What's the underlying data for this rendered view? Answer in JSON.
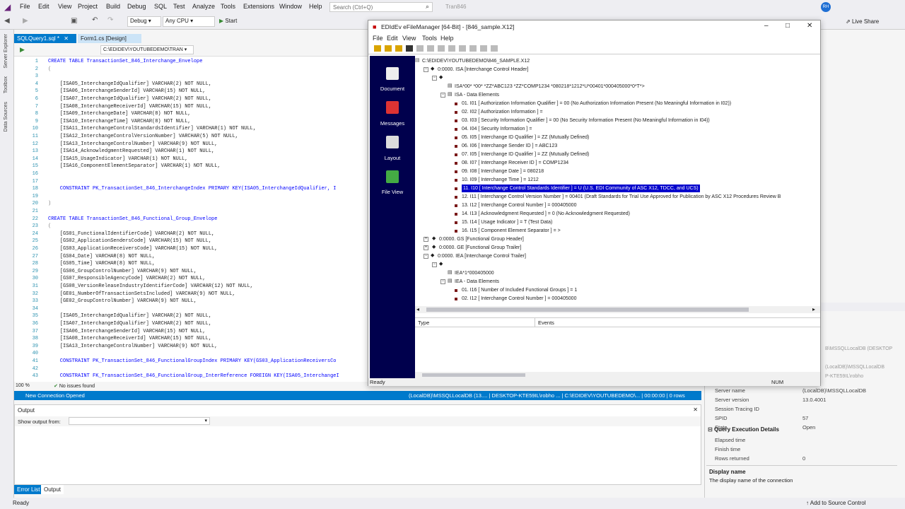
{
  "vs": {
    "menu": [
      "File",
      "Edit",
      "View",
      "Project",
      "Build",
      "Debug",
      "SQL",
      "Test",
      "Analyze",
      "Tools",
      "Extensions",
      "Window",
      "Help"
    ],
    "search_placeholder": "Search (Ctrl+Q)",
    "solution": "Tran846",
    "avatar": "RH",
    "live_share": "Live Share",
    "config": "Debug",
    "platform": "Any CPU",
    "start": "Start",
    "rail": [
      "Server Explorer",
      "Toolbox",
      "Data Sources"
    ],
    "tabs": [
      "SQLQuery1.sql *",
      "Form1.cs [Design]"
    ],
    "path": "C:\\EDIDEV\\YOUTUBEDEMO\\TRAN",
    "zoom": "100 %",
    "issues": "No issues found",
    "conn_status": "New Connection Opened",
    "conn_info": "(LocalDB)\\MSSQLLocalDB (13.... | DESKTOP-KTE59IL\\robho ... | C:\\EDIDEV\\YOUTUBEDEMO\\... | 00:00:00 | 0 rows",
    "output_title": "Output",
    "output_from": "Show output from:",
    "bottom_tabs": [
      "Error List",
      "Output"
    ],
    "status_left": "Ready",
    "status_right": "Add to Source Control"
  },
  "code": [
    {
      "n": "1",
      "t": "CREATE TABLE TransactionSet_846_Interchange_Envelope"
    },
    {
      "n": "2",
      "t": "("
    },
    {
      "n": "3",
      "t": ""
    },
    {
      "n": "4",
      "t": "    [ISA05_InterchangeIdQualifier] VARCHAR(2) NOT NULL,"
    },
    {
      "n": "5",
      "t": "    [ISA06_InterchangeSenderId] VARCHAR(15) NOT NULL,"
    },
    {
      "n": "6",
      "t": "    [ISA07_InterchangeIdQualifier] VARCHAR(2) NOT NULL,"
    },
    {
      "n": "7",
      "t": "    [ISA08_InterchangeReceiverId] VARCHAR(15) NOT NULL,"
    },
    {
      "n": "8",
      "t": "    [ISA09_InterchangeDate] VARCHAR(8) NOT NULL,"
    },
    {
      "n": "9",
      "t": "    [ISA10_InterchangeTime] VARCHAR(8) NOT NULL,"
    },
    {
      "n": "10",
      "t": "    [ISA11_InterchangeControlStandardsIdentifier] VARCHAR(1) NOT NULL,"
    },
    {
      "n": "11",
      "t": "    [ISA12_InterchangeControlVersionNumber] VARCHAR(5) NOT NULL,"
    },
    {
      "n": "12",
      "t": "    [ISA13_InterchangeControlNumber] VARCHAR(9) NOT NULL,"
    },
    {
      "n": "13",
      "t": "    [ISA14_AcknowledgmentRequested] VARCHAR(1) NOT NULL,"
    },
    {
      "n": "14",
      "t": "    [ISA15_UsageIndicator] VARCHAR(1) NOT NULL,"
    },
    {
      "n": "15",
      "t": "    [ISA16_ComponentElementSeparator] VARCHAR(1) NOT NULL,"
    },
    {
      "n": "16",
      "t": ""
    },
    {
      "n": "17",
      "t": ""
    },
    {
      "n": "18",
      "t": "    CONSTRAINT PK_TransactionSet_846_InterchangeIndex PRIMARY KEY(ISA05_InterchangeIdQualifier, I"
    },
    {
      "n": "19",
      "t": ""
    },
    {
      "n": "20",
      "t": ")"
    },
    {
      "n": "21",
      "t": ""
    },
    {
      "n": "22",
      "t": "CREATE TABLE TransactionSet_846_Functional_Group_Envelope"
    },
    {
      "n": "23",
      "t": "("
    },
    {
      "n": "24",
      "t": "    [GS01_FunctionalIdentifierCode] VARCHAR(2) NOT NULL,"
    },
    {
      "n": "25",
      "t": "    [GS02_ApplicationSendersCode] VARCHAR(15) NOT NULL,"
    },
    {
      "n": "26",
      "t": "    [GS03_ApplicationReceiversCode] VARCHAR(15) NOT NULL,"
    },
    {
      "n": "27",
      "t": "    [GS04_Date] VARCHAR(8) NOT NULL,"
    },
    {
      "n": "28",
      "t": "    [GS05_Time] VARCHAR(8) NOT NULL,"
    },
    {
      "n": "29",
      "t": "    [GS06_GroupControlNumber] VARCHAR(9) NOT NULL,"
    },
    {
      "n": "30",
      "t": "    [GS07_ResponsibleAgencyCode] VARCHAR(2) NOT NULL,"
    },
    {
      "n": "31",
      "t": "    [GS08_VersionReleaseIndustryIdentifierCode] VARCHAR(12) NOT NULL,"
    },
    {
      "n": "32",
      "t": "    [GE01_NumberOfTransactionSetsIncluded] VARCHAR(9) NOT NULL,"
    },
    {
      "n": "33",
      "t": "    [GE02_GroupControlNumber] VARCHAR(9) NOT NULL,"
    },
    {
      "n": "34",
      "t": ""
    },
    {
      "n": "35",
      "t": "    [ISA05_InterchangeIdQualifier] VARCHAR(2) NOT NULL,"
    },
    {
      "n": "36",
      "t": "    [ISA07_InterchangeIdQualifier] VARCHAR(2) NOT NULL,"
    },
    {
      "n": "37",
      "t": "    [ISA06_InterchangeSenderId] VARCHAR(15) NOT NULL,"
    },
    {
      "n": "38",
      "t": "    [ISA08_InterchangeReceiverId] VARCHAR(15) NOT NULL,"
    },
    {
      "n": "39",
      "t": "    [ISA13_InterchangeControlNumber] VARCHAR(9) NOT NULL,"
    },
    {
      "n": "40",
      "t": ""
    },
    {
      "n": "41",
      "t": "    CONSTRAINT PK_TransactionSet_846_FunctionalGroupIndex PRIMARY KEY(GS03_ApplicationReceiversCo"
    },
    {
      "n": "42",
      "t": ""
    },
    {
      "n": "43",
      "t": "    CONSTRAINT FK_TransactionSet_846_FunctionalGroup_InterReference FOREIGN KEY(ISA05_InterchangeI"
    }
  ],
  "edi": {
    "title": "EDIdEv eFileManager [64-Bit] - [846_sample.X12]",
    "menu": [
      "File",
      "Edit",
      "View",
      "Tools",
      "Help"
    ],
    "nav": [
      "Document",
      "Messages",
      "Layout",
      "File View"
    ],
    "events_cols": [
      "Type",
      "Events"
    ],
    "status": "Ready",
    "status_num": "NUM",
    "tree": [
      {
        "lvl": 0,
        "box": "",
        "t": "C:\\EDIDEV\\YOUTUBEDEMO\\846_SAMPLE.X12"
      },
      {
        "lvl": 1,
        "box": "-",
        "t": "0:0000. ISA [Interchange Control Header]"
      },
      {
        "lvl": 2,
        "box": "-",
        "t": ""
      },
      {
        "lvl": 3,
        "box": "",
        "t": "ISA*00*          *00*          *ZZ*ABC123         *ZZ*COMP1234       *080218*1212*U*00401*000405000*0*T*>"
      },
      {
        "lvl": 3,
        "box": "-",
        "t": "ISA - Data Elements"
      },
      {
        "lvl": 4,
        "box": "",
        "t": "01. I01 [ Authorization Information Qualifier ] = 00 (No Authorization Information Present (No Meaningful Information in I02))"
      },
      {
        "lvl": 4,
        "box": "",
        "t": "02. I02 [ Authorization Information ] ="
      },
      {
        "lvl": 4,
        "box": "",
        "t": "03. I03 [ Security Information Qualifier ] = 00 (No Security Information Present (No Meaningful Information in I04))"
      },
      {
        "lvl": 4,
        "box": "",
        "t": "04. I04 [ Security Information ] ="
      },
      {
        "lvl": 4,
        "box": "",
        "t": "05. I05 [ Interchange ID Qualifier ] = ZZ (Mutually Defined)"
      },
      {
        "lvl": 4,
        "box": "",
        "t": "06. I06 [ Interchange Sender ID ] = ABC123"
      },
      {
        "lvl": 4,
        "box": "",
        "t": "07. I05 [ Interchange ID Qualifier ] = ZZ (Mutually Defined)"
      },
      {
        "lvl": 4,
        "box": "",
        "t": "08. I07 [ Interchange Receiver ID ] = COMP1234"
      },
      {
        "lvl": 4,
        "box": "",
        "t": "09. I08 [ Interchange Date ] = 080218"
      },
      {
        "lvl": 4,
        "box": "",
        "t": "10. I09 [ Interchange Time ] = 1212"
      },
      {
        "lvl": 4,
        "box": "",
        "t": "11. I10 [ Interchange Control Standards Identifier ] = U (U.S. EDI Community of ASC X12, TDCC, and UCS)",
        "sel": true
      },
      {
        "lvl": 4,
        "box": "",
        "t": "12. I11 [ Interchange Control Version Number ] = 00401 (Draft Standards for Trial Use Approved for Publication by ASC X12 Procedures Review B"
      },
      {
        "lvl": 4,
        "box": "",
        "t": "13. I12 [ Interchange Control Number ] = 000405000"
      },
      {
        "lvl": 4,
        "box": "",
        "t": "14. I13 [ Acknowledgment Requested ] = 0 (No Acknowledgment Requested)"
      },
      {
        "lvl": 4,
        "box": "",
        "t": "15. I14 [ Usage Indicator ] = T (Test Data)"
      },
      {
        "lvl": 4,
        "box": "",
        "t": "16. I15 [ Component Element Separator ] = >"
      },
      {
        "lvl": 1.5,
        "box": "+",
        "t": "0:0000. GS [Functional Group Header]"
      },
      {
        "lvl": 1.5,
        "box": "+",
        "t": "0:0000. GE [Functional Group Trailer]"
      },
      {
        "lvl": 1,
        "box": "-",
        "t": "0:0000. IEA [Interchange Control Trailer]"
      },
      {
        "lvl": 2,
        "box": "-",
        "t": ""
      },
      {
        "lvl": 3,
        "box": "",
        "t": "IEA*1*000405000"
      },
      {
        "lvl": 3,
        "box": "-",
        "t": "IEA - Data Elements"
      },
      {
        "lvl": 4,
        "box": "",
        "t": "01. I16 [ Number of Included Functional Groups ] = 1"
      },
      {
        "lvl": 4,
        "box": "",
        "t": "02. I12 [ Interchange Control Number ] = 000405000"
      }
    ]
  },
  "props": {
    "rows": [
      {
        "k": "Server name",
        "v": "(LocalDB)\\MSSQLLocalDB"
      },
      {
        "k": "Server version",
        "v": "13.0.4001"
      },
      {
        "k": "Session Tracing ID",
        "v": ""
      },
      {
        "k": "SPID",
        "v": "57"
      },
      {
        "k": "State",
        "v": "Open"
      }
    ],
    "section": "Query Execution Details",
    "rows2": [
      {
        "k": "Elapsed time",
        "v": ""
      },
      {
        "k": "Finish time",
        "v": ""
      },
      {
        "k": "Rows returned",
        "v": "0"
      }
    ],
    "desc_title": "Display name",
    "desc": "The display name of the connection",
    "behind": [
      "B\\MSSQLLocalDB (DESKTOP",
      "(LocalDB)\\MSSQLLocalDB",
      "P-KTE59IL\\robho"
    ]
  },
  "colors": {
    "accent": "#007acc",
    "nav": "#00004d",
    "select": "#0000cc"
  }
}
